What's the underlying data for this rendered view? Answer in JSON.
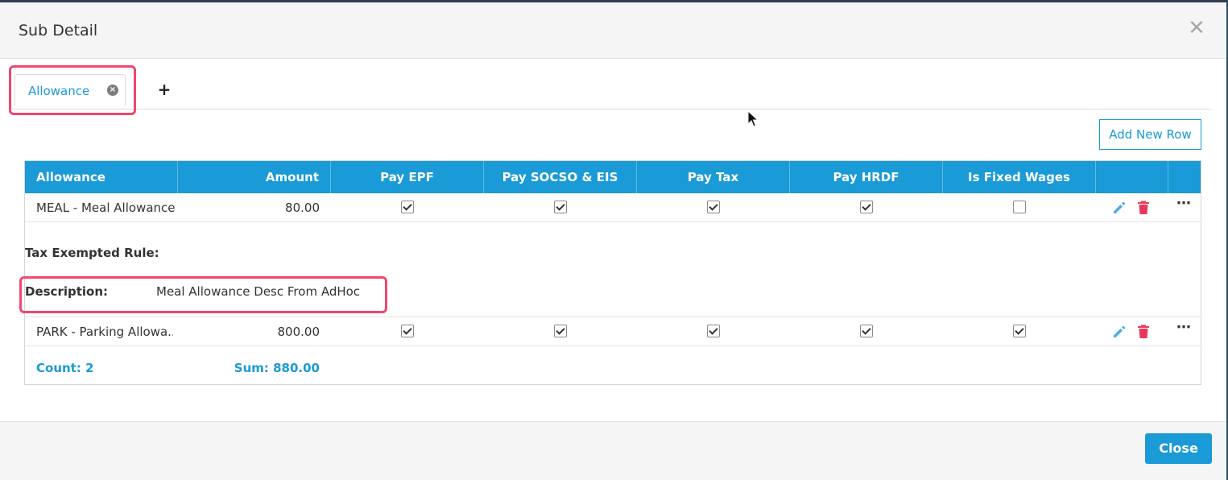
{
  "modal": {
    "title": "Sub Detail",
    "close_icon": "✕"
  },
  "tabs": [
    {
      "label": "Allowance",
      "close_icon": "×"
    }
  ],
  "add_tab_icon": "+",
  "add_row_label": "Add New Row",
  "grid": {
    "columns": [
      "Allowance",
      "Amount",
      "Pay EPF",
      "Pay SOCSO & EIS",
      "Pay Tax",
      "Pay HRDF",
      "Is Fixed Wages"
    ],
    "rows": [
      {
        "allowance": "MEAL - Meal Allowance",
        "amount": "80.00",
        "pay_epf": true,
        "pay_socso_eis": true,
        "pay_tax": true,
        "pay_hrdf": true,
        "is_fixed_wages": false,
        "detail": {
          "tax_exempted_label": "Tax Exempted Rule:",
          "tax_exempted_value": "",
          "description_label": "Description:",
          "description_value": "Meal Allowance Desc From AdHoc"
        }
      },
      {
        "allowance": "PARK - Parking Allowa...",
        "amount": "800.00",
        "pay_epf": true,
        "pay_socso_eis": true,
        "pay_tax": true,
        "pay_hrdf": true,
        "is_fixed_wages": true
      }
    ],
    "footer": {
      "count": "Count: 2",
      "sum": "Sum: 880.00"
    }
  },
  "close_label": "Close",
  "colors": {
    "accent": "#1a9ad6",
    "highlight": "#f0476e",
    "delete": "#e8395a"
  }
}
